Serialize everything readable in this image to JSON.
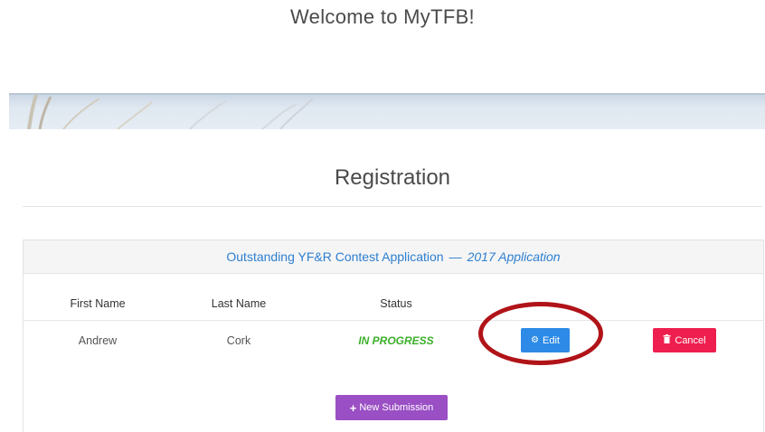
{
  "header": {
    "welcome": "Welcome to MyTFB!"
  },
  "registration": {
    "title": "Registration"
  },
  "panel": {
    "title": "Outstanding YF&R Contest Application",
    "separator": "—",
    "subtitle": "2017 Application"
  },
  "table": {
    "columns": [
      "First Name",
      "Last Name",
      "Status"
    ],
    "rows": [
      {
        "first_name": "Andrew",
        "last_name": "Cork",
        "status": "IN PROGRESS",
        "edit_label": "Edit",
        "cancel_label": "Cancel"
      }
    ]
  },
  "actions": {
    "new_submission_label": "New Submission"
  },
  "icons": {
    "edit": "gear-icon",
    "cancel": "trash-icon",
    "new": "plus-icon"
  },
  "colors": {
    "link_blue": "#2d7fd0",
    "status_green": "#3cb02a",
    "edit_blue": "#2d8ae6",
    "cancel_red": "#ee1f4e",
    "new_purple": "#9a4fc4",
    "highlight_red": "#b01318"
  }
}
